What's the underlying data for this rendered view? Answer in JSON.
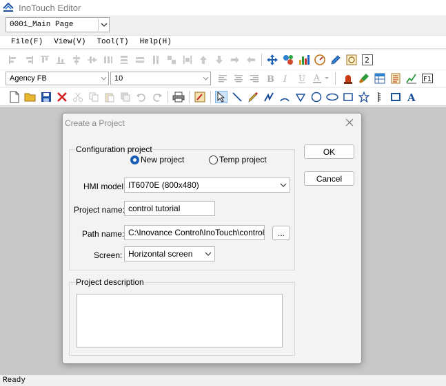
{
  "app": {
    "title": "InoTouch Editor"
  },
  "page_selector": {
    "value": "0001_Main Page"
  },
  "menubar": {
    "items": [
      "File(F)",
      "View(V)",
      "Tool(T)",
      "Help(H)"
    ]
  },
  "font_bar": {
    "font_name": "Agency FB",
    "font_size": "10"
  },
  "dialog": {
    "title": "Create a Project",
    "config_group_label": "Configuration project",
    "radio_new": "New project",
    "radio_temp": "Temp project",
    "selected_radio": "New project",
    "hmi_model_label": "HMI model:",
    "hmi_model_value": "IT6070E (800x480)",
    "project_name_label": "Project name:",
    "project_name_value": "control tutorial",
    "path_name_label": "Path name:",
    "path_name_value": "C:\\Inovance Control\\InoTouch\\control tu",
    "browse_label": "...",
    "screen_label": "Screen:",
    "screen_value": "Horizontal screen",
    "description_label": "Project description",
    "description_value": "",
    "ok_label": "OK",
    "cancel_label": "Cancel"
  },
  "status": {
    "text": "Ready"
  },
  "colors": {
    "accent": "#1a5fb4",
    "workspace": "#c8c8c8"
  }
}
